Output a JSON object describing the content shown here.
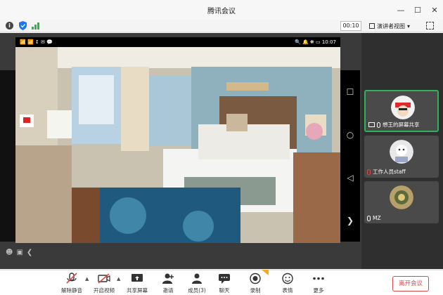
{
  "window": {
    "title": "腾讯会议",
    "controls": [
      "—",
      "☐",
      "✕"
    ]
  },
  "status": {
    "timer": "00:10",
    "view_label": "演讲者视图"
  },
  "phone_status": {
    "left": "📶 📶 ↕ ✉ 💬",
    "right": "🔍 🔔 ❋ ▭ 10:07"
  },
  "phone_nav": {
    "square": "☐",
    "circle": "○",
    "back": "◁",
    "next": "❯"
  },
  "stage_controls": {
    "emoji": "☻",
    "chat": "▣",
    "collapse": "❮"
  },
  "participants": [
    {
      "name": "想王的屏幕共享",
      "sharing": true
    },
    {
      "name": "工作人员staff",
      "sharing": false
    },
    {
      "name": "MZ",
      "sharing": false
    }
  ],
  "toolbar": {
    "mute_label": "解除静音",
    "video_label": "开启视频",
    "share_label": "共享屏幕",
    "invite_label": "邀请",
    "members_label": "成员(3)",
    "chat_label": "聊天",
    "record_label": "录制",
    "emoji_label": "表情",
    "more_label": "更多",
    "end_label": "离开会议"
  },
  "colors": {
    "accent_green": "#2fb25b",
    "end_red": "#e04747"
  }
}
